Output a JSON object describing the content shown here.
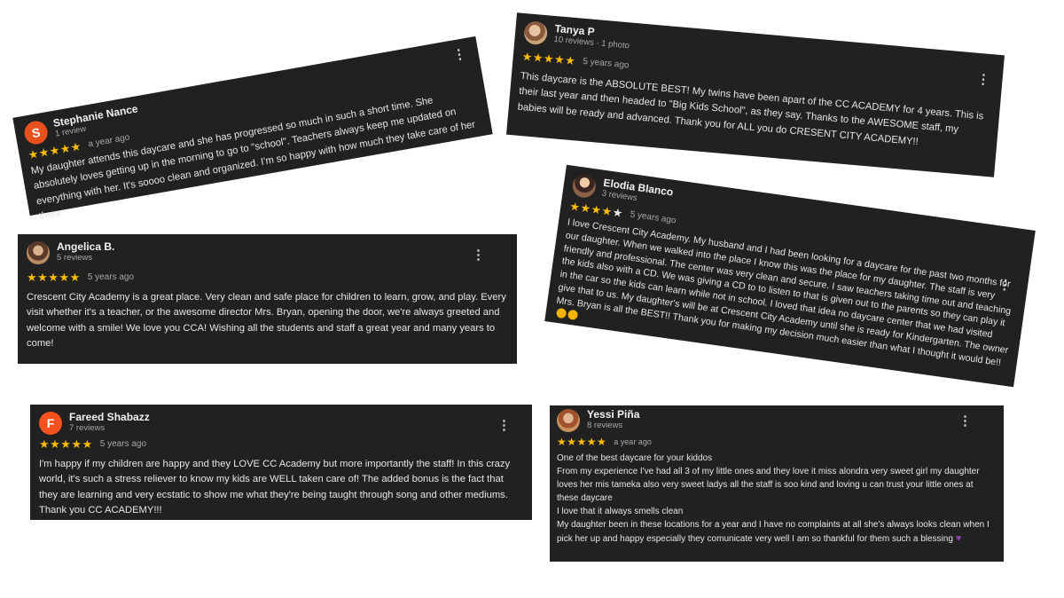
{
  "reviews": {
    "stephanie": {
      "initial": "S",
      "avatar_color": "#e8501e",
      "name": "Stephanie Nance",
      "meta": "1 review",
      "stars": 5,
      "when": "a year ago",
      "text": "My daughter attends this daycare and she has progressed so much in such a short time. She absolutely loves getting up in the morning to go to \"school\". Teachers always keep me updated on everything with her. It's soooo clean and organized. I'm so happy with how much they take care of her there"
    },
    "tanya": {
      "name": "Tanya P",
      "meta": "10 reviews · 1 photo",
      "stars": 5,
      "when": "5 years ago",
      "text": "This daycare is the ABSOLUTE BEST! My twins have been apart of the CC ACADEMY for 4 years. This is their last year and then headed to \"Big Kids School\", as they say. Thanks to the AWESOME staff, my babies will be ready and advanced. Thank you for ALL you do CRESENT CITY ACADEMY!!"
    },
    "angelica": {
      "name": "Angelica B.",
      "meta": "5 reviews",
      "stars": 5,
      "when": "5 years ago",
      "text": "Crescent City Academy is a great place. Very clean and safe place for children to learn, grow, and play. Every visit whether it's a teacher, or the awesome director Mrs. Bryan, opening the door, we're always greeted and welcome with a smile! We love you CCA! Wishing all the students and staff a great year and many years to come!"
    },
    "elodia": {
      "name": "Elodia Blanco",
      "meta": "3 reviews",
      "stars": 4,
      "when": "5 years ago",
      "text": "I love Crescent City Academy. My husband and I had been looking for a daycare for the past two months for our daughter. When we walked into the place I know this was the place for my daughter. The staff is very friendly and professional. The center was very clean and secure. I saw teachers taking time out and teaching the kids also with a CD. We was giving a CD to to listen to that is given out to the parents so they can play it in the car so the kids can learn while not in school. I loved that idea no daycare center that we had visited give that to us. My daughter's will be at Crescent City Academy until she is ready for Kindergarten. The owner Mrs. Bryan is all the BEST!! Thank you for making my decision much easier than what I thought it would be!!"
    },
    "fareed": {
      "initial": "F",
      "avatar_color": "#f4511e",
      "name": "Fareed Shabazz",
      "meta": "7 reviews",
      "stars": 5,
      "when": "5 years ago",
      "text": "I'm happy if my children are happy and they LOVE CC Academy but more importantly the staff! In this crazy world, it's such a stress reliever to know my kids are WELL taken care of! The added bonus is the fact that they are learning and very ecstatic to show me what they're being taught through song and other mediums. Thank you CC ACADEMY!!!"
    },
    "yessi": {
      "name": "Yessi Piña",
      "meta": "8 reviews",
      "stars": 5,
      "when": "a year ago",
      "text": "One of the best daycare for your kiddos\nFrom my experience I've had all 3 of my little ones and they love it miss alondra very sweet girl my daughter loves her mis tameka also very sweet ladys all the staff is soo kind and loving u can trust your little ones at these daycare\nI love that it always smells clean\nMy daughter been in these locations for a year and I have no complaints at all she's always looks clean when I pick her up and happy especially they comunicate very well I am so thankful for them such a blessing"
    }
  },
  "icons": {
    "star": "★",
    "more": "⋮"
  }
}
